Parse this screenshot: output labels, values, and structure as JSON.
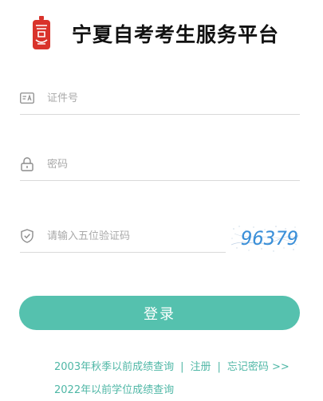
{
  "header": {
    "title": "宁夏自考考生服务平台",
    "logo_color": "#d9332b"
  },
  "form": {
    "id_field": {
      "placeholder": "证件号",
      "value": "",
      "icon": "id-card-icon"
    },
    "password_field": {
      "placeholder": "密码",
      "value": "",
      "icon": "lock-icon"
    },
    "captcha_field": {
      "placeholder": "请输入五位验证码",
      "value": "",
      "icon": "shield-check-icon"
    },
    "captcha_image_text": "96379",
    "login_label": "登录"
  },
  "links": {
    "pre_2003_scores": "2003年秋季以前成绩查询",
    "separator": "|",
    "register": "注册",
    "forgot_password": "忘记密码 >>",
    "pre_2022_degree_scores": "2022年以前学位成绩查询"
  },
  "colors": {
    "accent": "#55c1ae",
    "link": "#4fb7a6",
    "captcha_digits": "#3a8fd8"
  }
}
